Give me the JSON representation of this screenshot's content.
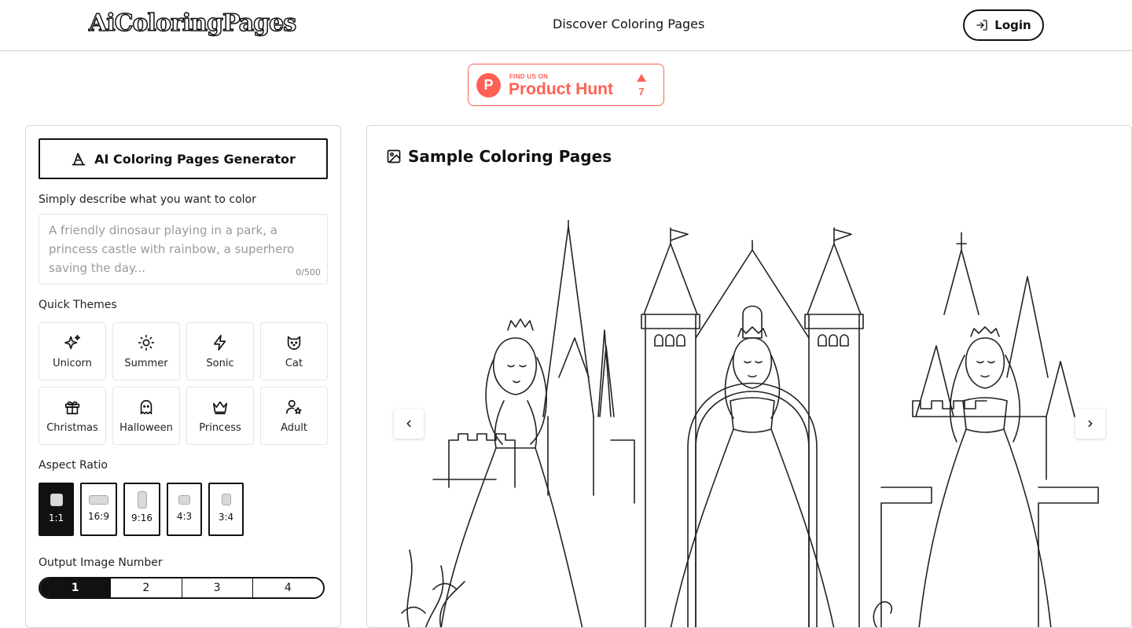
{
  "header": {
    "logo": "AiColoringPages",
    "nav_link": "Discover Coloring Pages",
    "login_label": "Login"
  },
  "product_hunt": {
    "small_text": "FIND US ON",
    "big_text": "Product Hunt",
    "upvotes": "7",
    "color": "#ff6154"
  },
  "generator": {
    "button_label": "AI Coloring Pages Generator",
    "prompt_label": "Simply describe what you want to color",
    "prompt_placeholder": "A friendly dinosaur playing in a park, a princess castle with rainbow, a superhero saving the day...",
    "prompt_counter": "0/500",
    "themes_label": "Quick Themes",
    "themes": [
      {
        "label": "Unicorn",
        "icon": "sparkles-icon"
      },
      {
        "label": "Summer",
        "icon": "sun-icon"
      },
      {
        "label": "Sonic",
        "icon": "lightning-icon"
      },
      {
        "label": "Cat",
        "icon": "cat-icon"
      },
      {
        "label": "Christmas",
        "icon": "gift-icon"
      },
      {
        "label": "Halloween",
        "icon": "ghost-icon"
      },
      {
        "label": "Princess",
        "icon": "crown-icon"
      },
      {
        "label": "Adult",
        "icon": "user-star-icon"
      }
    ],
    "aspect_label": "Aspect Ratio",
    "aspect_ratios": [
      {
        "label": "1:1",
        "selected": true
      },
      {
        "label": "16:9",
        "selected": false
      },
      {
        "label": "9:16",
        "selected": false
      },
      {
        "label": "4:3",
        "selected": false
      },
      {
        "label": "3:4",
        "selected": false
      }
    ],
    "output_label": "Output Image Number",
    "output_numbers": [
      {
        "label": "1",
        "selected": true
      },
      {
        "label": "2",
        "selected": false
      },
      {
        "label": "3",
        "selected": false
      },
      {
        "label": "4",
        "selected": false
      }
    ]
  },
  "samples": {
    "title": "Sample Coloring Pages"
  }
}
